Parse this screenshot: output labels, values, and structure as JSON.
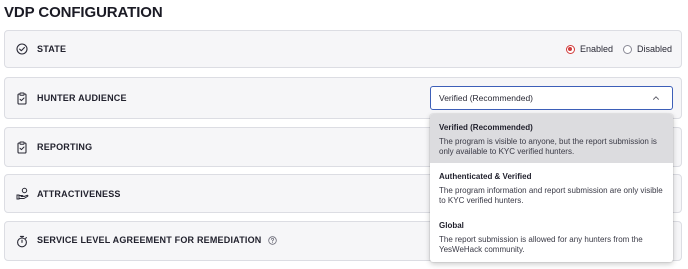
{
  "page": {
    "title": "VDP CONFIGURATION"
  },
  "state": {
    "label": "STATE",
    "icon": "check-circle-icon",
    "options": [
      {
        "label": "Enabled",
        "checked": true
      },
      {
        "label": "Disabled",
        "checked": false
      }
    ],
    "accent_color": "#d13a3a"
  },
  "hunter_audience": {
    "label": "HUNTER AUDIENCE",
    "icon": "clipboard-check-icon",
    "select": {
      "value": "Verified (Recommended)",
      "open": true,
      "options": [
        {
          "title": "Verified (Recommended)",
          "description": "The program is visible to anyone, but the report submission is only available to KYC verified hunters.",
          "selected": true
        },
        {
          "title": "Authenticated & Verified",
          "description": "The program information and report submission are only visible to KYC verified hunters.",
          "selected": false
        },
        {
          "title": "Global",
          "description": "The report submission is allowed for any hunters from the YesWeHack community.",
          "selected": false
        }
      ]
    },
    "border_color": "#3d5fb8"
  },
  "reporting": {
    "label": "REPORTING",
    "icon": "clipboard-check-icon"
  },
  "attractiveness": {
    "label": "ATTRACTIVENESS",
    "icon": "hand-coins-icon"
  },
  "sla": {
    "label": "SERVICE LEVEL AGREEMENT FOR REMEDIATION",
    "icon": "stopwatch-icon",
    "help_icon": "question-circle-icon"
  }
}
